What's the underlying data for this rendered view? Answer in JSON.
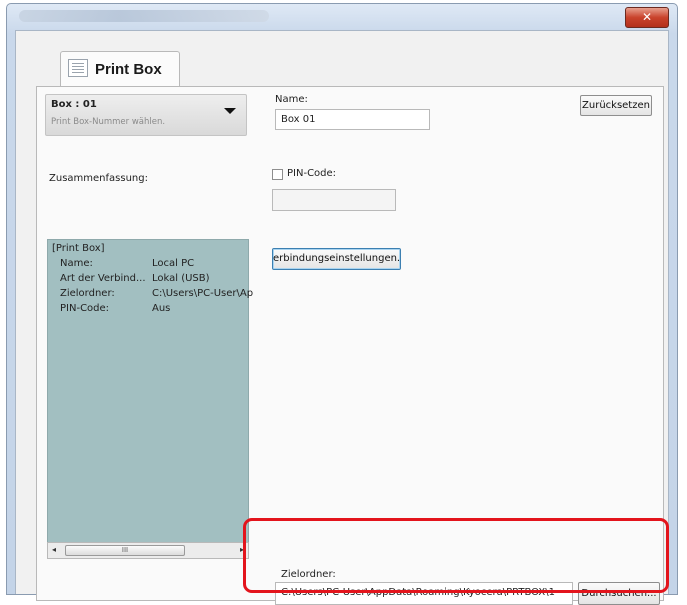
{
  "window": {
    "title": "",
    "close_glyph": "✕"
  },
  "tab": {
    "label": "Print Box",
    "icon": "document-icon"
  },
  "box_selector": {
    "value": "Box : 01",
    "hint": "Print Box-Nummer wählen."
  },
  "name_field": {
    "label": "Name:",
    "value": "Box 01"
  },
  "reset_button": {
    "label": "Zurücksetzen"
  },
  "pin": {
    "label": "PIN-Code:",
    "checked": false,
    "value": ""
  },
  "connection_button": {
    "label": "erbindungseinstellungen..."
  },
  "summary": {
    "label": "Zusammenfassung:",
    "header": "[Print Box]",
    "rows": [
      {
        "key": "Name:",
        "value": "Local PC"
      },
      {
        "key": "Art der Verbind...",
        "value": "Lokal (USB)"
      },
      {
        "key": "Zielordner:",
        "value": "C:\\Users\\PC-User\\Ap"
      },
      {
        "key": "PIN-Code:",
        "value": "Aus"
      }
    ],
    "scroll_thumb_glyph": "III",
    "scroll_left_glyph": "◂",
    "scroll_right_glyph": "▸"
  },
  "target_folder": {
    "label": "Zielordner:",
    "value": "C:\\Users\\PC-User\\AppData\\Roaming\\Kyocera\\PRTBOX\\1",
    "browse_label": "Durchsuchen..."
  },
  "colors": {
    "summary_background": "#a2bfc1",
    "highlight_border": "#e3141c",
    "close_button": "#c9432c"
  }
}
